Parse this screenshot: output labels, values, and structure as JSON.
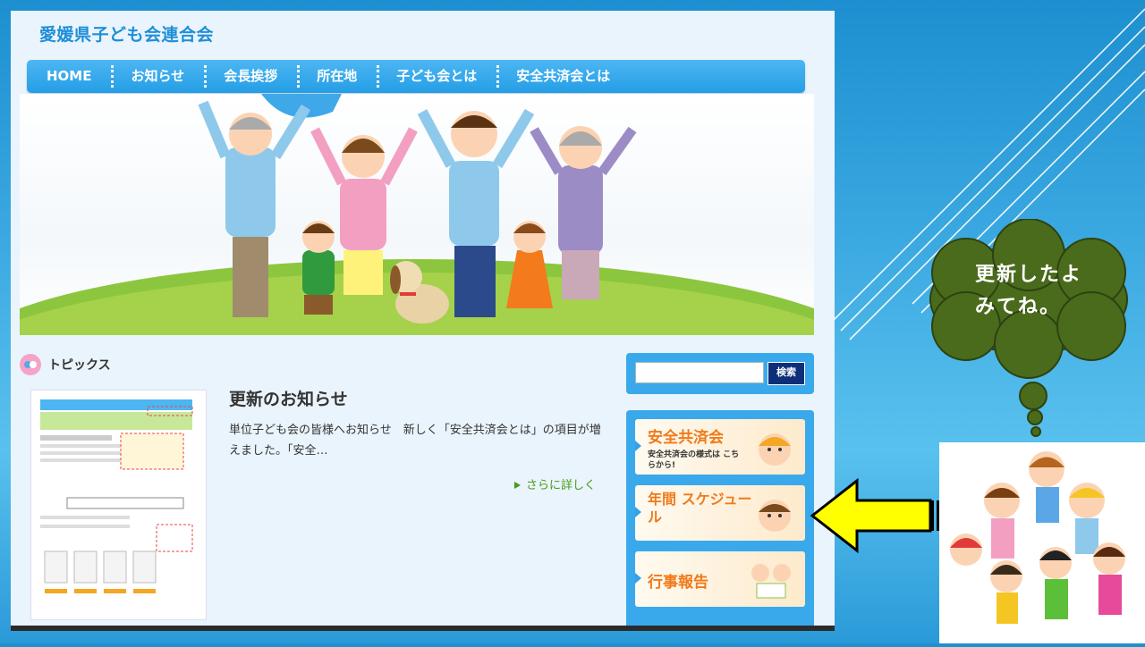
{
  "site": {
    "title": "愛媛県子ども会連合会",
    "nav": [
      "HOME",
      "お知らせ",
      "会長挨拶",
      "所在地",
      "子ども会とは",
      "安全共済会とは"
    ]
  },
  "topics": {
    "heading": "トピックス",
    "post": {
      "title": "更新のお知らせ",
      "excerpt": "単位子ども会の皆様へお知らせ　新しく「安全共済会とは」の項目が増えました。「安全…",
      "more_label": "さらに詳しく"
    }
  },
  "sidebar": {
    "search_placeholder": "",
    "search_button": "検索",
    "banners": [
      {
        "title": "安全共済会",
        "subtitle": "安全共済会の様式は こちらから!"
      },
      {
        "title": "年間 スケジュール"
      },
      {
        "title": "行事報告"
      }
    ]
  },
  "callout": {
    "line1": "更新したよ",
    "line2": "みてね。"
  },
  "colors": {
    "accent": "#249ee6",
    "bubble": "#4a6b1c",
    "arrow": "#ffff00"
  }
}
